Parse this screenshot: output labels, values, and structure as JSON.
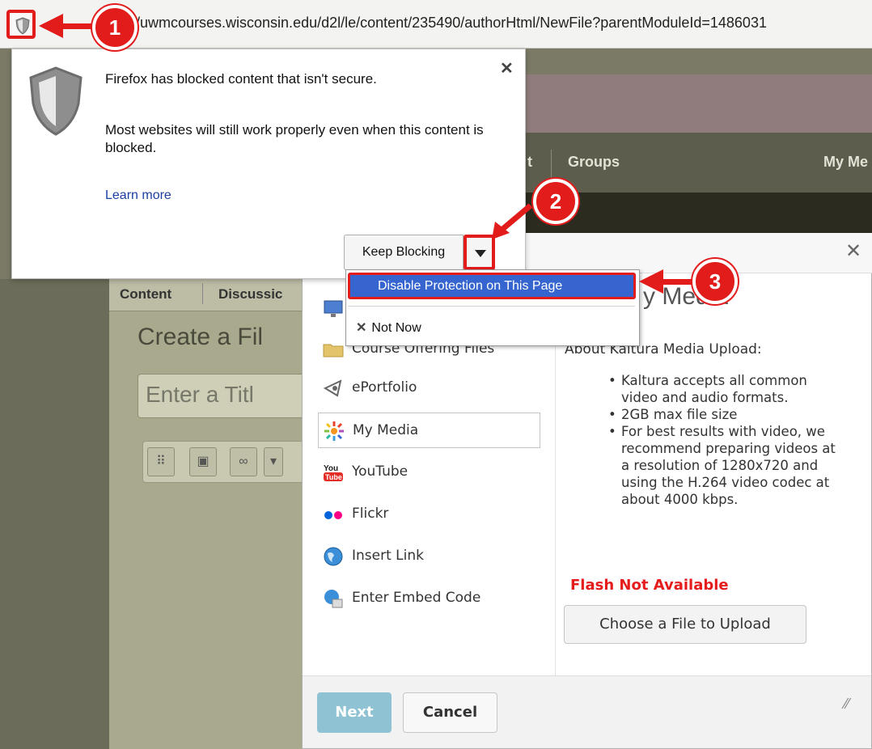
{
  "browser": {
    "url": "/uwmcourses.wisconsin.edu/d2l/le/content/235490/authorHtml/NewFile?parentModuleId=1486031"
  },
  "security_popup": {
    "main_text": "Firefox has blocked content that isn't secure.",
    "sub_text": "Most websites will still work properly even when this content is blocked.",
    "learn_more": "Learn more",
    "keep_blocking": "Keep Blocking",
    "menu": {
      "disable": "Disable Protection on This Page",
      "not_now": "Not Now"
    }
  },
  "lms": {
    "nav": {
      "partial": "t",
      "groups": "Groups",
      "my_media": "My Me"
    },
    "tabs": {
      "content": "Content",
      "discussions": "Discussic"
    },
    "create_title": "Create a Fil",
    "title_placeholder": "Enter a Titl"
  },
  "insert_dialog": {
    "heading_partial": "y Media",
    "sources": [
      {
        "label": "Course Offering Files",
        "icon": "folder-icon"
      },
      {
        "label": "ePortfolio",
        "icon": "eportfolio-icon"
      },
      {
        "label": "My Media",
        "icon": "kaltura-icon"
      },
      {
        "label": "YouTube",
        "icon": "youtube-icon"
      },
      {
        "label": "Flickr",
        "icon": "flickr-icon"
      },
      {
        "label": "Insert Link",
        "icon": "globe-icon"
      },
      {
        "label": "Enter Embed Code",
        "icon": "embed-icon"
      }
    ],
    "about_title": "About Kaltura Media Upload:",
    "about_items": [
      "Kaltura accepts all common video and audio formats.",
      "2GB max file size",
      "For best results with video, we recommend preparing videos at a resolution of 1280x720 and using the H.264 video codec at about 4000 kbps."
    ],
    "flash_status": "Flash Not Available",
    "choose_button": "Choose a File to Upload",
    "next_button": "Next",
    "cancel_button": "Cancel"
  },
  "callouts": [
    "1",
    "2",
    "3"
  ],
  "colors": {
    "callout_red": "#e21b1b",
    "menu_highlight": "#3665cf",
    "flash_red": "#e51c1c"
  }
}
